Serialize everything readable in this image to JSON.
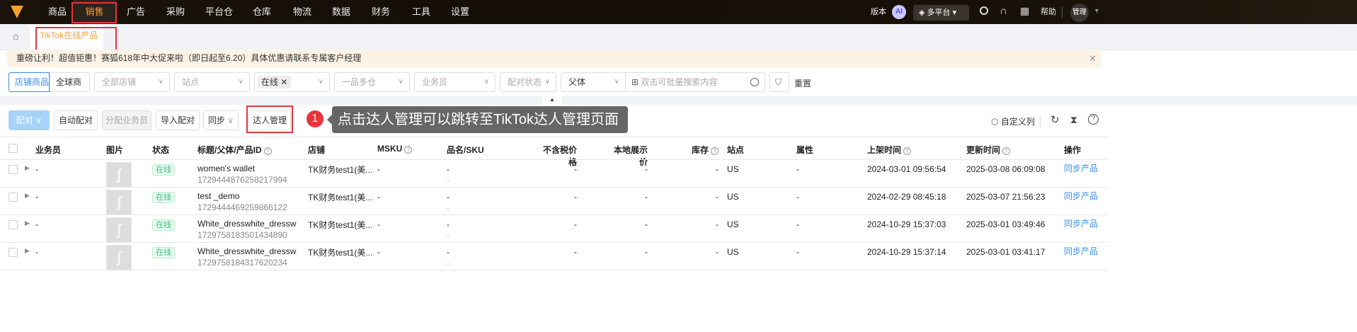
{
  "nav": {
    "items": [
      "商品",
      "销售",
      "广告",
      "采购",
      "平台仓",
      "仓库",
      "物流",
      "数据",
      "财务",
      "工具",
      "设置"
    ],
    "active": "销售",
    "version": "版本",
    "ai": "AI",
    "platform": "多平台",
    "help": "帮助",
    "user": "管理"
  },
  "tabs": {
    "current": "TikTok在线产品"
  },
  "notice": "重磅让利！超值钜惠！赛狐618年中大促来啦（即日起至6.20）具体优惠请联系专属客户经理",
  "filters": {
    "store_products": "店铺商品",
    "global_products": "全球商品",
    "all_stores": "全部店铺",
    "site": "站点",
    "status_tag": "在线",
    "multi_warehouse": "一品多仓",
    "salesperson": "业务员",
    "match_status": "配对状态",
    "parent": "父体",
    "search_placeholder": "双击可批量搜索内容",
    "reset": "重置"
  },
  "toolbar": {
    "match": "配对",
    "auto_match": "自动配对",
    "assign": "分配业务员",
    "import_match": "导入配对",
    "sync": "同步",
    "influencer": "达人管理",
    "custom_columns": "自定义列"
  },
  "callout": {
    "number": "1",
    "text": "点击达人管理可以跳转至TikTok达人管理页面"
  },
  "table": {
    "headers": [
      "业务员",
      "图片",
      "状态",
      "标题/父体/产品ID",
      "店铺",
      "MSKU",
      "品名/SKU",
      "不含税价格",
      "本地展示价",
      "库存",
      "站点",
      "属性",
      "上架时间",
      "更新时间",
      "操作"
    ],
    "rows": [
      {
        "salesperson": "-",
        "status": "在线",
        "title": "women's wallet",
        "id": "1729444876258217994",
        "store": "TK财务test1(美...",
        "msku": "-",
        "name": "-",
        "sku": "-",
        "price": "-",
        "local_price": "-",
        "stock": "-",
        "site": "US",
        "attr": "-",
        "listed": "2024-03-01 09:56:54",
        "updated": "2025-03-08 06:09:08",
        "action": "同步产品"
      },
      {
        "salesperson": "-",
        "status": "在线",
        "title": "test _demo",
        "id": "1729444469259866122",
        "store": "TK财务test1(美...",
        "msku": "-",
        "name": "-",
        "sku": "-",
        "price": "-",
        "local_price": "-",
        "stock": "-",
        "site": "US",
        "attr": "-",
        "listed": "2024-02-29 08:45:18",
        "updated": "2025-03-07 21:56:23",
        "action": "同步产品"
      },
      {
        "salesperson": "-",
        "status": "在线",
        "title": "White_dresswhite_dressw...",
        "id": "1729758183501434890",
        "store": "TK财务test1(美...",
        "msku": "-",
        "name": "-",
        "sku": "-",
        "price": "-",
        "local_price": "-",
        "stock": "-",
        "site": "US",
        "attr": "-",
        "listed": "2024-10-29 15:37:03",
        "updated": "2025-03-01 03:49:46",
        "action": "同步产品"
      },
      {
        "salesperson": "-",
        "status": "在线",
        "title": "White_dresswhite_dressw...",
        "id": "1729758184317620234",
        "store": "TK财务test1(美...",
        "msku": "-",
        "name": "-",
        "sku": "-",
        "price": "-",
        "local_price": "-",
        "stock": "-",
        "site": "US",
        "attr": "-",
        "listed": "2024-10-29 15:37:14",
        "updated": "2025-03-01 03:41:17",
        "action": "同步产品"
      }
    ]
  }
}
